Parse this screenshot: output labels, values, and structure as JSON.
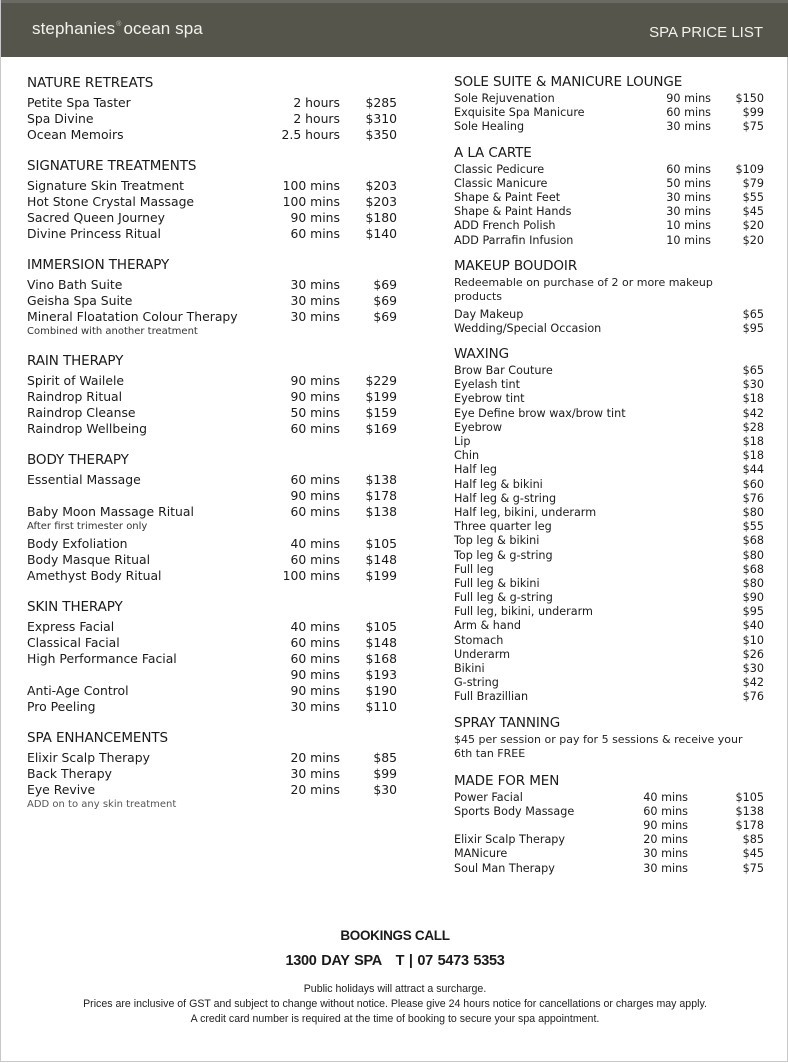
{
  "header": {
    "brand": "stephanies",
    "brand_mark": "®",
    "brand_suffix": "ocean spa",
    "title": "SPA PRICE LIST"
  },
  "left_sections": [
    {
      "title": "NATURE RETREATS",
      "items": [
        {
          "name": "Petite Spa Taster",
          "duration": "2 hours",
          "price": "$285"
        },
        {
          "name": "Spa Divine",
          "duration": "2 hours",
          "price": "$310"
        },
        {
          "name": "Ocean Memoirs",
          "duration": "2.5 hours",
          "price": "$350"
        }
      ]
    },
    {
      "title": "SIGNATURE TREATMENTS",
      "items": [
        {
          "name": "Signature Skin Treatment",
          "duration": "100 mins",
          "price": "$203"
        },
        {
          "name": "Hot Stone Crystal Massage",
          "duration": "100 mins",
          "price": "$203"
        },
        {
          "name": "Sacred Queen Journey",
          "duration": "90 mins",
          "price": "$180"
        },
        {
          "name": "Divine Princess Ritual",
          "duration": "60 mins",
          "price": "$140"
        }
      ]
    },
    {
      "title": "IMMERSION THERAPY",
      "items": [
        {
          "name": "Vino Bath Suite",
          "duration": "30 mins",
          "price": "$69"
        },
        {
          "name": "Geisha Spa Suite",
          "duration": "30 mins",
          "price": "$69"
        },
        {
          "name": "Mineral Floatation Colour Therapy",
          "duration": "30 mins",
          "price": "$69"
        }
      ],
      "note": "Combined with another treatment"
    },
    {
      "title": "RAIN THERAPY",
      "items": [
        {
          "name": "Spirit of Wailele",
          "duration": "90 mins",
          "price": "$229"
        },
        {
          "name": "Raindrop Ritual",
          "duration": "90 mins",
          "price": "$199"
        },
        {
          "name": "Raindrop Cleanse",
          "duration": "50 mins",
          "price": "$159"
        },
        {
          "name": "Raindrop Wellbeing",
          "duration": "60 mins",
          "price": "$169"
        }
      ]
    },
    {
      "title": "BODY THERAPY",
      "items": [
        {
          "name": "Essential Massage",
          "duration": "60 mins",
          "price": "$138"
        },
        {
          "name": "",
          "duration": "90 mins",
          "price": "$178"
        },
        {
          "name": "Baby Moon Massage Ritual",
          "duration": "60 mins",
          "price": "$138"
        },
        {
          "name": "Body Exfoliation",
          "duration": "40 mins",
          "price": "$105"
        },
        {
          "name": "Body Masque Ritual",
          "duration": "60 mins",
          "price": "$148"
        },
        {
          "name": "Amethyst Body Ritual",
          "duration": "100 mins",
          "price": "$199"
        }
      ],
      "note_after_item_3": "After first trimester only"
    },
    {
      "title": "SKIN THERAPY",
      "items": [
        {
          "name": "Express Facial",
          "duration": "40 mins",
          "price": "$105"
        },
        {
          "name": "Classical Facial",
          "duration": "60 mins",
          "price": "$148"
        },
        {
          "name": "High Performance Facial",
          "duration": "60 mins",
          "price": "$168"
        },
        {
          "name": "",
          "duration": "90 mins",
          "price": "$193"
        },
        {
          "name": "Anti-Age Control",
          "duration": "90 mins",
          "price": "$190"
        },
        {
          "name": "Pro Peeling",
          "duration": "30 mins",
          "price": "$110"
        }
      ]
    },
    {
      "title": "SPA ENHANCEMENTS",
      "items": [
        {
          "name": "Elixir Scalp Therapy",
          "duration": "20 mins",
          "price": "$85"
        },
        {
          "name": "Back Therapy",
          "duration": "30 mins",
          "price": "$99"
        },
        {
          "name": "Eye Revive",
          "duration": "20 mins",
          "price": "$30"
        }
      ],
      "note": "ADD on to any skin treatment"
    }
  ],
  "right_sections": [
    {
      "title": "SOLE SUITE & MANICURE LOUNGE",
      "items": [
        {
          "name": "Sole Rejuvenation",
          "duration": "90 mins",
          "price": "$150"
        },
        {
          "name": "Exquisite Spa Manicure",
          "duration": "60 mins",
          "price": "$99"
        },
        {
          "name": "Sole Healing",
          "duration": "30 mins",
          "price": "$75"
        }
      ]
    },
    {
      "title": "A LA CARTE",
      "items": [
        {
          "name": "Classic Pedicure",
          "duration": "60 mins",
          "price": "$109"
        },
        {
          "name": "Classic Manicure",
          "duration": "50 mins",
          "price": "$79"
        },
        {
          "name": "Shape & Paint Feet",
          "duration": "30 mins",
          "price": "$55"
        },
        {
          "name": "Shape & Paint Hands",
          "duration": "30 mins",
          "price": "$45"
        },
        {
          "name": "ADD French Polish",
          "duration": "10 mins",
          "price": "$20"
        },
        {
          "name": "ADD Parrafin Infusion",
          "duration": "10 mins",
          "price": "$20"
        }
      ]
    },
    {
      "title": "MAKEUP BOUDOIR",
      "note": "Redeemable on purchase of 2 or more makeup products",
      "items": [
        {
          "name": "Day Makeup",
          "price": "$65"
        },
        {
          "name": "Wedding/Special Occasion",
          "price": "$95"
        }
      ]
    },
    {
      "title": "WAXING",
      "items": [
        {
          "name": "Brow Bar Couture",
          "price": "$65"
        },
        {
          "name": "Eyelash tint",
          "price": "$30"
        },
        {
          "name": "Eyebrow tint",
          "price": "$18"
        },
        {
          "name": "Eye Define brow wax/brow tint",
          "price": "$42"
        },
        {
          "name": "Eyebrow",
          "price": "$28"
        },
        {
          "name": "Lip",
          "price": "$18"
        },
        {
          "name": "Chin",
          "price": "$18"
        },
        {
          "name": "Half leg",
          "price": "$44"
        },
        {
          "name": "Half leg & bikini",
          "price": "$60"
        },
        {
          "name": "Half leg & g-string",
          "price": "$76"
        },
        {
          "name": "Half leg, bikini, underarm",
          "price": "$80"
        },
        {
          "name": "Three quarter leg",
          "price": "$55"
        },
        {
          "name": "Top leg & bikini",
          "price": "$68"
        },
        {
          "name": "Top leg & g-string",
          "price": "$80"
        },
        {
          "name": "Full leg",
          "price": "$68"
        },
        {
          "name": "Full leg & bikini",
          "price": "$80"
        },
        {
          "name": "Full leg & g-string",
          "price": "$90"
        },
        {
          "name": "Full leg, bikini, underarm",
          "price": "$95"
        },
        {
          "name": "Arm & hand",
          "price": "$40"
        },
        {
          "name": "Stomach",
          "price": "$10"
        },
        {
          "name": "Underarm",
          "price": "$26"
        },
        {
          "name": "Bikini",
          "price": "$30"
        },
        {
          "name": "G-string",
          "price": "$42"
        },
        {
          "name": "Full Brazillian",
          "price": "$76"
        }
      ]
    },
    {
      "title": "SPRAY TANNING",
      "note": "$45 per session or pay for 5 sessions & receive your 6th tan FREE"
    },
    {
      "title": "MADE FOR MEN",
      "items": [
        {
          "name": "Power Facial",
          "duration": "40 mins",
          "price": "$105"
        },
        {
          "name": "Sports Body Massage",
          "duration": "60 mins",
          "price": "$138"
        },
        {
          "name": "",
          "duration": "90 mins",
          "price": "$178"
        },
        {
          "name": "Elixir Scalp Therapy",
          "duration": "20 mins",
          "price": "$85"
        },
        {
          "name": "MANicure",
          "duration": "30 mins",
          "price": "$45"
        },
        {
          "name": "Soul Man Therapy",
          "duration": "30 mins",
          "price": "$75"
        }
      ]
    }
  ],
  "footer": {
    "bookings_title": "BOOKINGS CALL",
    "phone_line": "1300 DAY SPA   T | 07 5473 5353",
    "fine_print": [
      "Public holidays will attract a surcharge.",
      "Prices are inclusive of GST and subject to change without notice. Please give 24 hours notice for cancellations or charges may apply.",
      "A credit card number is required at the time of booking to secure your spa appointment."
    ]
  }
}
